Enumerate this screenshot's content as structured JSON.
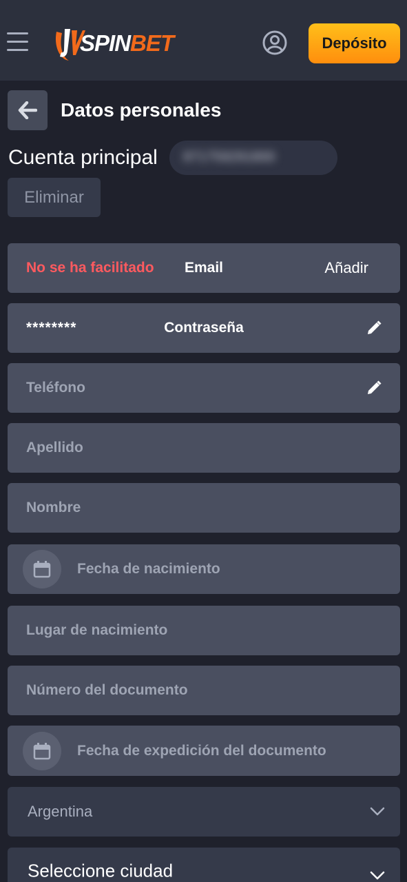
{
  "header": {
    "logo_prefix": "JV",
    "logo_white": "SPIN",
    "logo_orange": "BET",
    "deposit_label": "Depósito"
  },
  "page": {
    "title": "Datos personales",
    "account_label": "Cuenta principal",
    "account_id": "871759291800",
    "delete_label": "Eliminar"
  },
  "fields": {
    "email": {
      "status": "No se ha facilitado",
      "label": "Email",
      "action": "Añadir"
    },
    "password": {
      "value": "********",
      "label": "Contraseña"
    },
    "phone": {
      "placeholder": "Teléfono"
    },
    "surname": {
      "placeholder": "Apellido"
    },
    "name": {
      "placeholder": "Nombre"
    },
    "birth_date": {
      "placeholder": "Fecha de nacimiento"
    },
    "birth_place": {
      "placeholder": "Lugar de nacimiento"
    },
    "document_number": {
      "placeholder": "Número del documento"
    },
    "document_date": {
      "placeholder": "Fecha de expedición del documento"
    },
    "country": {
      "value": "Argentina"
    },
    "city": {
      "value": "Seleccione ciudad"
    }
  },
  "colors": {
    "background": "#1f212c",
    "topbar": "#2c303d",
    "field": "#4a4f60",
    "accent_orange": "#ff9d13",
    "error_red": "#ff5a5f"
  },
  "icons": {
    "menu": "hamburger-icon",
    "account": "user-circle-icon",
    "back": "arrow-left-icon",
    "edit": "pencil-icon",
    "calendar": "calendar-icon",
    "dropdown": "chevron-down-icon"
  }
}
